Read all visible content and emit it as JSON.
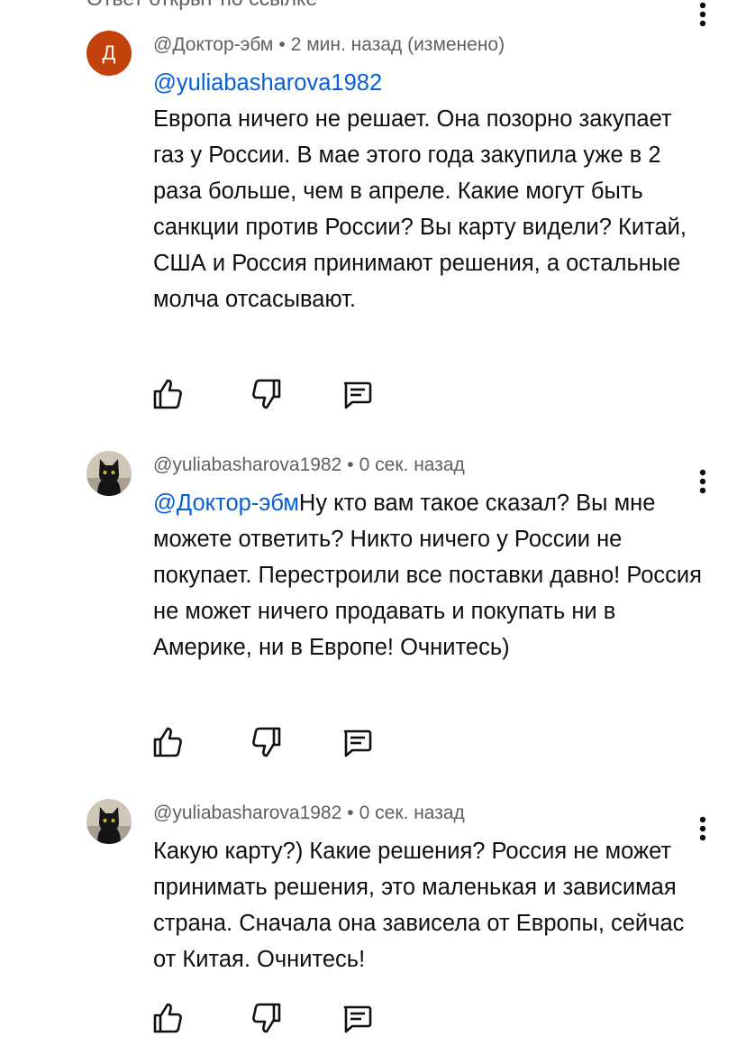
{
  "thread_header": {
    "label": "Ответ открыт по ссылке"
  },
  "comments": [
    {
      "avatar_letter": "Д",
      "avatar_color": "#c2410c",
      "author": "@Доктор-эбм",
      "separator": "•",
      "time": "2 мин. назад (изменено)",
      "mention": "@yuliabasharova1982",
      "text": "Европа ничего не решает. Она позорно закупает газ у России. В мае этого года закупила уже в 2 раза больше, чем в апреле. Какие могут быть санкции против России? Вы карту видели? Китай, США и Россия принимают решения, а остальные молча отсасывают."
    },
    {
      "avatar_icon": "black-cat-avatar",
      "author": "@yuliabasharova1982",
      "separator": "•",
      "time": "0 сек. назад",
      "mention": "@Доктор-эбм",
      "text": "Ну кто вам такое сказал? Вы мне можете ответить? Никто ничего у России не покупает. Перестроили все поставки давно! Россия не может ничего продавать и покупать ни в Америке, ни в Европе! Очнитесь)"
    },
    {
      "avatar_icon": "black-cat-avatar",
      "author": "@yuliabasharova1982",
      "separator": "•",
      "time": "0 сек. назад",
      "text": "Какую карту?) Какие решения? Россия не может принимать решения, это маленькая и зависимая страна. Сначала она зависела от Европы, сейчас от Китая. Очнитесь!"
    }
  ],
  "icons": {
    "like": "thumb-up-icon",
    "dislike": "thumb-down-icon",
    "reply": "reply-comment-icon",
    "menu": "more-vertical-icon"
  },
  "colors": {
    "mention": "#065fd4",
    "meta": "#606060",
    "text": "#0f0f0f"
  }
}
